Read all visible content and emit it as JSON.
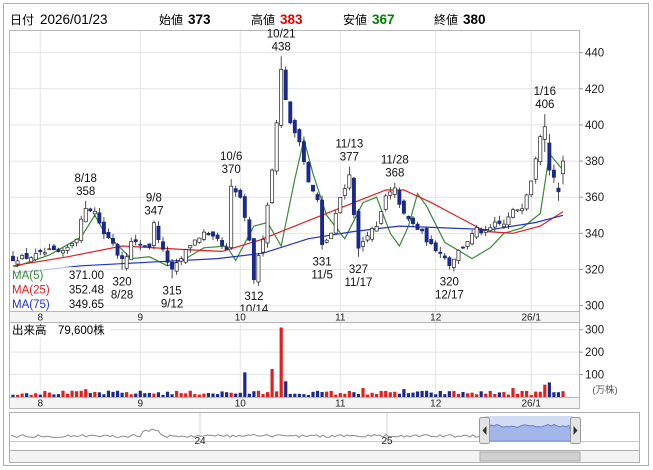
{
  "header": {
    "date_label": "日付",
    "date_value": "2026/01/23",
    "open_label": "始値",
    "open_value": "373",
    "high_label": "高値",
    "high_value": "383",
    "low_label": "安値",
    "low_value": "367",
    "close_label": "終値",
    "close_value": "380",
    "colors": {
      "high": "#e60000",
      "low": "#008000",
      "label": "#000000"
    }
  },
  "chart_data": [
    {
      "type": "candlestick",
      "title": "",
      "x_ticks": [
        "8",
        "9",
        "10",
        "11",
        "12",
        "26/1"
      ],
      "y_ticks": [
        "300",
        "320",
        "340",
        "360",
        "380",
        "400",
        "420",
        "440"
      ],
      "ylim": [
        297,
        452
      ],
      "days": 122,
      "month_starts": [
        6,
        28,
        50,
        72,
        93,
        114
      ],
      "moving_averages": [
        {
          "name": "MA(5)",
          "value": "371.00",
          "color": "#3a8a3a"
        },
        {
          "name": "MA(25)",
          "value": "352.48",
          "color": "#e02020"
        },
        {
          "name": "MA(75)",
          "value": "349.65",
          "color": "#2233cc"
        }
      ],
      "ma_paths": {
        "ma5": [
          [
            0,
            321
          ],
          [
            8,
            328
          ],
          [
            15,
            338
          ],
          [
            18,
            350
          ],
          [
            20,
            341
          ],
          [
            26,
            326
          ],
          [
            30,
            327
          ],
          [
            34,
            322
          ],
          [
            38,
            326
          ],
          [
            42,
            332
          ],
          [
            47,
            333
          ],
          [
            49,
            325
          ],
          [
            53,
            344
          ],
          [
            56,
            346
          ],
          [
            59,
            333
          ],
          [
            62,
            370
          ],
          [
            64,
            392
          ],
          [
            66,
            373
          ],
          [
            69,
            350
          ],
          [
            73,
            337
          ],
          [
            77,
            357
          ],
          [
            80,
            360
          ],
          [
            83,
            340
          ],
          [
            85,
            333
          ],
          [
            87,
            344
          ],
          [
            89,
            362
          ],
          [
            91,
            355
          ],
          [
            95,
            335
          ],
          [
            101,
            326
          ],
          [
            105,
            332
          ],
          [
            108,
            340
          ],
          [
            112,
            343
          ],
          [
            116,
            351
          ],
          [
            118,
            384
          ],
          [
            121,
            375
          ]
        ],
        "ma25": [
          [
            0,
            322
          ],
          [
            12,
            327
          ],
          [
            24,
            333
          ],
          [
            38,
            331
          ],
          [
            46,
            330
          ],
          [
            54,
            336
          ],
          [
            62,
            344
          ],
          [
            70,
            352
          ],
          [
            78,
            360
          ],
          [
            82,
            364
          ],
          [
            86,
            364
          ],
          [
            92,
            357
          ],
          [
            98,
            349
          ],
          [
            104,
            341
          ],
          [
            110,
            340
          ],
          [
            116,
            344
          ],
          [
            121,
            352
          ]
        ],
        "ma75": [
          [
            0,
            318
          ],
          [
            15,
            322
          ],
          [
            30,
            324
          ],
          [
            45,
            326
          ],
          [
            55,
            329
          ],
          [
            65,
            337
          ],
          [
            75,
            341
          ],
          [
            85,
            344
          ],
          [
            95,
            343
          ],
          [
            105,
            342
          ],
          [
            115,
            346
          ],
          [
            121,
            350
          ]
        ]
      },
      "annotations": [
        {
          "type": "high",
          "date": "8/18",
          "value": "358",
          "day": 16,
          "price": 358
        },
        {
          "type": "high",
          "date": "9/8",
          "value": "347",
          "day": 31,
          "price": 347
        },
        {
          "type": "high",
          "date": "10/6",
          "value": "370",
          "day": 48,
          "price": 370
        },
        {
          "type": "high",
          "date": "10/21",
          "value": "438",
          "day": 59,
          "price": 438
        },
        {
          "type": "high",
          "date": "11/13",
          "value": "377",
          "day": 74,
          "price": 377
        },
        {
          "type": "high",
          "date": "11/28",
          "value": "368",
          "day": 84,
          "price": 368
        },
        {
          "type": "high",
          "date": "1/16",
          "value": "406",
          "day": 117,
          "price": 406
        },
        {
          "type": "low",
          "date": "8/28",
          "value": "320",
          "day": 24,
          "price": 320
        },
        {
          "type": "low",
          "date": "9/12",
          "value": "315",
          "day": 35,
          "price": 315
        },
        {
          "type": "low",
          "date": "10/14",
          "value": "312",
          "day": 53,
          "price": 312
        },
        {
          "type": "low",
          "date": "11/5",
          "value": "331",
          "day": 68,
          "price": 331
        },
        {
          "type": "low",
          "date": "11/17",
          "value": "327",
          "day": 76,
          "price": 327
        },
        {
          "type": "low",
          "date": "12/17",
          "value": "320",
          "day": 96,
          "price": 320
        }
      ],
      "keypoints": [
        [
          0,
          326
        ],
        [
          4,
          327
        ],
        [
          8,
          330
        ],
        [
          11,
          329
        ],
        [
          14,
          338
        ],
        [
          16,
          355
        ],
        [
          18,
          352
        ],
        [
          20,
          340
        ],
        [
          22,
          335
        ],
        [
          24,
          322
        ],
        [
          26,
          335
        ],
        [
          28,
          334
        ],
        [
          30,
          333
        ],
        [
          31,
          345
        ],
        [
          33,
          330
        ],
        [
          35,
          319
        ],
        [
          37,
          326
        ],
        [
          39,
          334
        ],
        [
          42,
          340
        ],
        [
          43,
          338
        ],
        [
          45,
          336
        ],
        [
          47,
          330
        ],
        [
          48,
          365
        ],
        [
          50,
          360
        ],
        [
          52,
          335
        ],
        [
          53,
          315
        ],
        [
          55,
          338
        ],
        [
          57,
          375
        ],
        [
          59,
          430
        ],
        [
          61,
          400
        ],
        [
          63,
          392
        ],
        [
          65,
          368
        ],
        [
          67,
          358
        ],
        [
          68,
          333
        ],
        [
          70,
          340
        ],
        [
          72,
          360
        ],
        [
          74,
          372
        ],
        [
          76,
          331
        ],
        [
          78,
          340
        ],
        [
          80,
          343
        ],
        [
          82,
          360
        ],
        [
          84,
          364
        ],
        [
          86,
          350
        ],
        [
          88,
          345
        ],
        [
          90,
          340
        ],
        [
          92,
          333
        ],
        [
          94,
          330
        ],
        [
          96,
          323
        ],
        [
          98,
          330
        ],
        [
          100,
          336
        ],
        [
          102,
          342
        ],
        [
          104,
          340
        ],
        [
          106,
          345
        ],
        [
          108,
          345
        ],
        [
          110,
          352
        ],
        [
          112,
          355
        ],
        [
          114,
          370
        ],
        [
          116,
          395
        ],
        [
          117,
          400
        ],
        [
          119,
          378
        ],
        [
          120,
          364
        ],
        [
          121,
          380
        ]
      ],
      "candles": [
        {
          "day": 117,
          "open": 392,
          "high": 406,
          "low": 385,
          "close": 399
        },
        {
          "day": 118,
          "open": 390,
          "high": 395,
          "low": 372,
          "close": 375
        },
        {
          "day": 119,
          "open": 375,
          "high": 378,
          "low": 368,
          "close": 371
        },
        {
          "day": 120,
          "open": 365,
          "high": 368,
          "low": 358,
          "close": 363
        },
        {
          "day": 121,
          "open": 373,
          "high": 383,
          "low": 367,
          "close": 380
        }
      ],
      "ylabel": "",
      "xlabel": "",
      "grid": true
    },
    {
      "type": "bar",
      "title": "出来高",
      "value_label": "79,600株",
      "y_ticks": [
        "100",
        "200",
        "300"
      ],
      "ylim": [
        0,
        330
      ],
      "unit": "(万株)",
      "x_ticks": [
        "8",
        "9",
        "10",
        "11",
        "12",
        "26/1"
      ],
      "peaks": [
        [
          16,
          35
        ],
        [
          51,
          110
        ],
        [
          57,
          125
        ],
        [
          59,
          310
        ],
        [
          60,
          70
        ],
        [
          77,
          40
        ],
        [
          86,
          35
        ],
        [
          110,
          40
        ],
        [
          117,
          55
        ],
        [
          118,
          65
        ]
      ],
      "base_volume": 22
    },
    {
      "type": "area",
      "title": "",
      "x_ticks": [
        "24",
        "25"
      ],
      "range_selection": "last 6 months",
      "series_color": "#7c97e0"
    }
  ]
}
